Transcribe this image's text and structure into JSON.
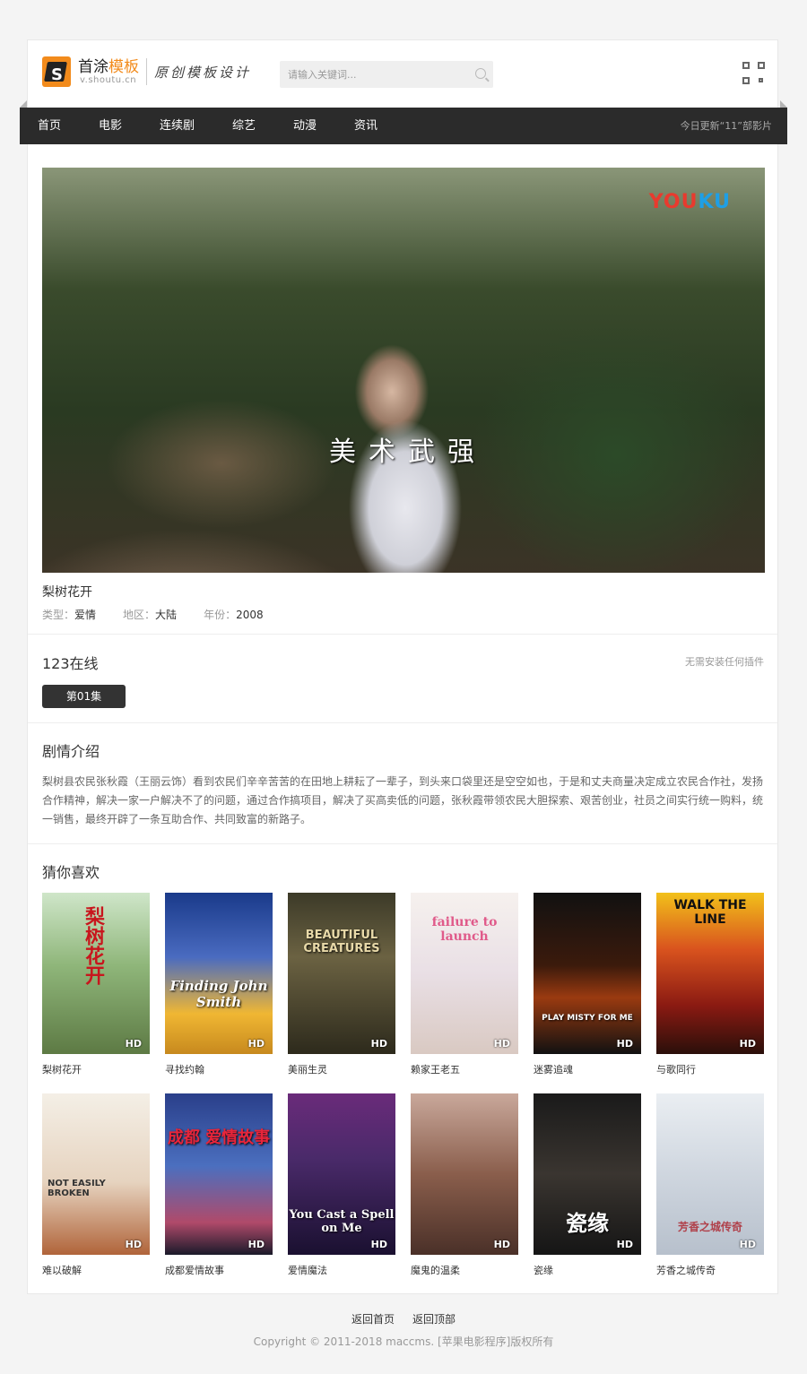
{
  "header": {
    "logo_title_1": "首涂",
    "logo_title_2": "模板",
    "logo_sub": "v.shoutu.cn",
    "slogan": "原创模板设计",
    "search_placeholder": "请输入关键词..."
  },
  "nav": {
    "items": [
      "首页",
      "电影",
      "连续剧",
      "综艺",
      "动漫",
      "资讯"
    ],
    "update_text": "今日更新“11”部影片"
  },
  "player": {
    "watermark": "YOUKU",
    "subtitle": "美术武强"
  },
  "film": {
    "title": "梨树花开",
    "type_label": "类型：",
    "type_value": "爱情",
    "region_label": "地区：",
    "region_value": "大陆",
    "year_label": "年份：",
    "year_value": "2008"
  },
  "source": {
    "title": "123在线",
    "tip": "无需安装任何插件",
    "episode": "第01集"
  },
  "synopsis": {
    "title": "剧情介绍",
    "text": "梨树县农民张秋霞（王丽云饰）看到农民们辛辛苦苦的在田地上耕耘了一辈子，到头来口袋里还是空空如也，于是和丈夫商量决定成立农民合作社，发扬合作精神，解决一家一户解决不了的问题，通过合作搞项目，解决了买高卖低的问题，张秋霞带领农民大胆探索、艰苦创业，社员之间实行统一购料，统一销售，最终开辟了一条互助合作、共同致富的新路子。"
  },
  "recommend": {
    "title": "猜你喜欢",
    "badge": "HD",
    "items": [
      {
        "name": "梨树花开",
        "art": "梨树花开"
      },
      {
        "name": "寻找约翰",
        "art": "Finding John Smith"
      },
      {
        "name": "美丽生灵",
        "art": "BEAUTIFUL CREATURES"
      },
      {
        "name": "赖家王老五",
        "art": "failure to launch"
      },
      {
        "name": "迷雾追魂",
        "art": "PLAY MISTY FOR ME"
      },
      {
        "name": "与歌同行",
        "art": "WALK THE LINE"
      },
      {
        "name": "难以破解",
        "art": "NOT EASILY BROKEN"
      },
      {
        "name": "成都爱情故事",
        "art": "成都 爱情故事"
      },
      {
        "name": "爱情魔法",
        "art": "You Cast a Spell on Me"
      },
      {
        "name": "魔鬼的温柔",
        "art": ""
      },
      {
        "name": "瓷缘",
        "art": "瓷缘"
      },
      {
        "name": "芳香之城传奇",
        "art": "芳香之城传奇"
      }
    ]
  },
  "footer": {
    "home": "返回首页",
    "top": "返回顶部",
    "copyright": "Copyright © 2011-2018 maccms. [苹果电影程序]版权所有"
  },
  "colors": {
    "accent": "#f28b1c",
    "nav_bg": "#2b2b2b",
    "button_bg": "#333333"
  }
}
